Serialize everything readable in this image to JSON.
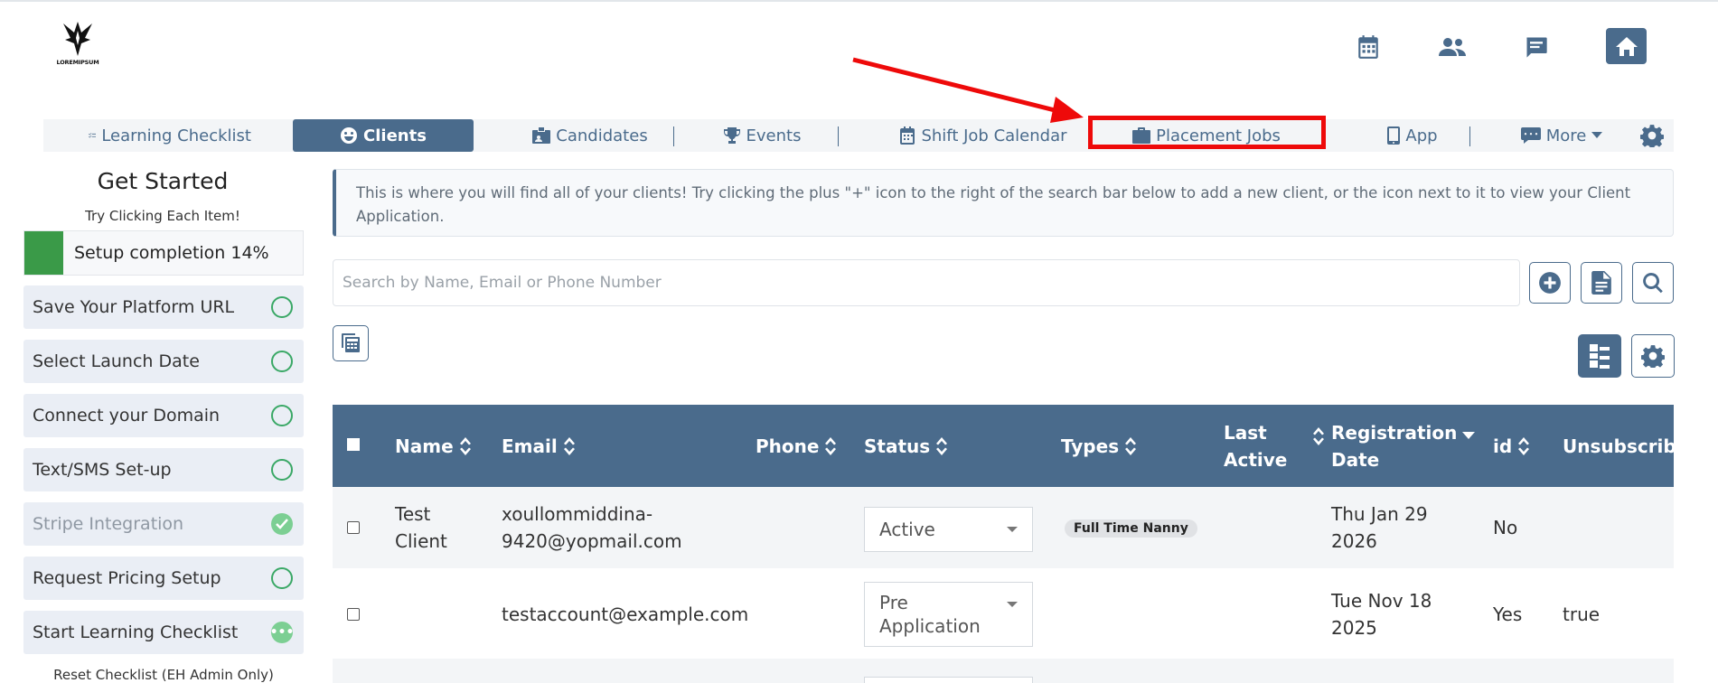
{
  "logo": {
    "text": "LOREMIPSUM"
  },
  "header": {
    "icons": [
      "calendar-icon",
      "users-icon",
      "chat-icon",
      "home-icon"
    ]
  },
  "nav": {
    "items": [
      {
        "label": "Learning Checklist",
        "icon": "checklist-icon"
      },
      {
        "label": "Clients",
        "icon": "smile-icon",
        "active": true
      },
      {
        "label": "Candidates",
        "icon": "id-card-icon"
      },
      {
        "label": "Events",
        "icon": "trophy-icon"
      },
      {
        "label": "Shift Job Calendar",
        "icon": "calendar-icon"
      },
      {
        "label": "Placement Jobs",
        "icon": "briefcase-icon",
        "highlighted": true
      },
      {
        "label": "App",
        "icon": "mobile-icon"
      },
      {
        "label": "More",
        "icon": "message-icon"
      }
    ]
  },
  "sidebar": {
    "title": "Get Started",
    "subtitle": "Try Clicking Each Item!",
    "progress_label": "Setup completion 14%",
    "progress": 14,
    "items": [
      {
        "label": "Save Your Platform URL",
        "state": "open"
      },
      {
        "label": "Select Launch Date",
        "state": "open"
      },
      {
        "label": "Connect your Domain",
        "state": "open"
      },
      {
        "label": "Text/SMS Set-up",
        "state": "open"
      },
      {
        "label": "Stripe Integration",
        "state": "done"
      },
      {
        "label": "Request Pricing Setup",
        "state": "open"
      },
      {
        "label": "Start Learning Checklist",
        "state": "in-progress"
      }
    ],
    "reset_label": "Reset Checklist (EH Admin Only)"
  },
  "main": {
    "info_text": "This is where you will find all of your clients! Try clicking the plus \"+\" icon to the right of the search bar below to add a new client, or the icon next to it to view your Client Application.",
    "search_placeholder": "Search by Name, Email or Phone Number"
  },
  "table": {
    "headers": {
      "name": "Name",
      "email": "Email",
      "phone": "Phone",
      "status": "Status",
      "types": "Types",
      "last_active_1": "Last",
      "last_active_2": "Active",
      "registration_1": "Registration",
      "registration_2": "Date",
      "id": "id",
      "unsubscribed": "Unsubscribed"
    },
    "rows": [
      {
        "name_1": "Test",
        "name_2": "Client",
        "email_1": "xoullommiddina-",
        "email_2": "9420@yopmail.com",
        "phone": "",
        "status": "Active",
        "type": "Full Time Nanny",
        "last_active": "",
        "reg_1": "Thu Jan 29",
        "reg_2": "2026",
        "id": "No",
        "unsubscribed": ""
      },
      {
        "name_1": "",
        "name_2": "",
        "email_1": "testaccount@example.com",
        "email_2": "",
        "phone": "",
        "status_1": "Pre",
        "status_2": "Application",
        "type": "",
        "last_active": "",
        "reg_1": "Tue Nov 18",
        "reg_2": "2025",
        "id": "Yes",
        "unsubscribed": "true"
      }
    ]
  },
  "colors": {
    "primary": "#4a6b8c",
    "success": "#3a9a48",
    "highlight": "#ee0a0a"
  }
}
